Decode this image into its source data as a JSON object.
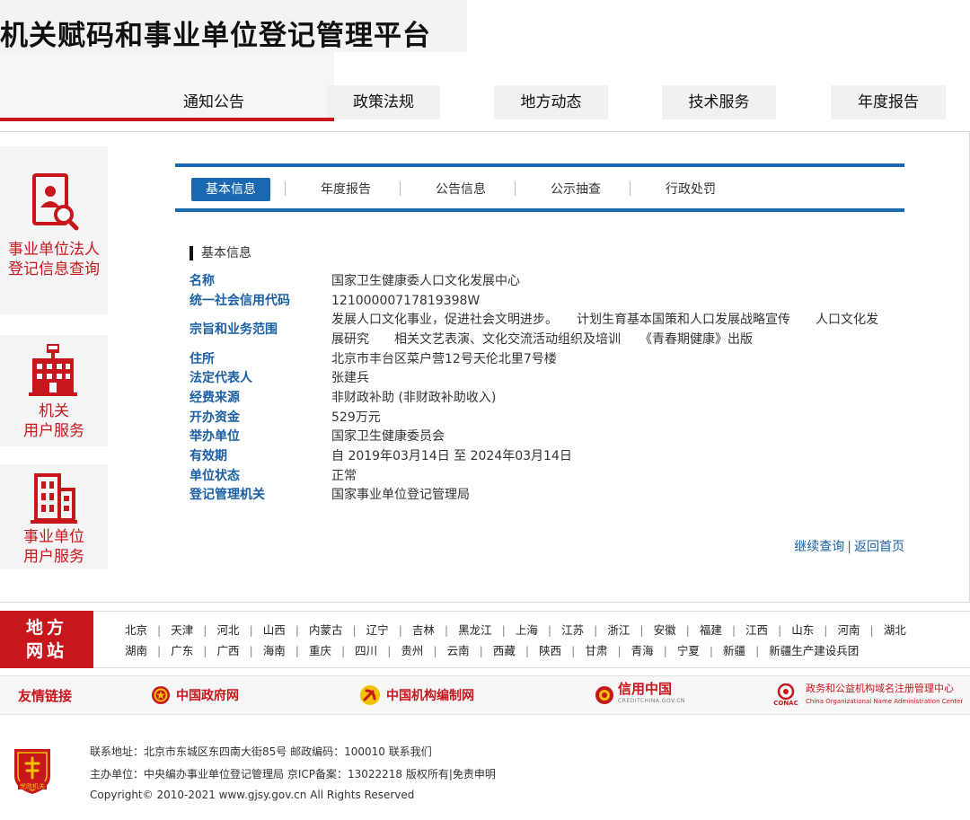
{
  "header": {
    "site_title": "机关赋码和事业单位登记管理平台",
    "nav": [
      {
        "label": "通知公告"
      },
      {
        "label": "政策法规"
      },
      {
        "label": "地方动态"
      },
      {
        "label": "技术服务"
      },
      {
        "label": "年度报告"
      }
    ]
  },
  "sidebar": {
    "items": [
      {
        "label_line1": "事业单位法人",
        "label_line2": "登记信息查询",
        "icon": "person-search-icon"
      },
      {
        "label_line1": "机关",
        "label_line2": "用户服务",
        "icon": "government-building-icon"
      },
      {
        "label_line1": "事业单位",
        "label_line2": "用户服务",
        "icon": "office-building-icon"
      }
    ]
  },
  "tabs": [
    {
      "label": "基本信息"
    },
    {
      "label": "年度报告"
    },
    {
      "label": "公告信息"
    },
    {
      "label": "公示抽查"
    },
    {
      "label": "行政处罚"
    }
  ],
  "info": {
    "section_title": "基本信息",
    "rows": [
      {
        "label": "名称",
        "value": "国家卫生健康委人口文化发展中心"
      },
      {
        "label": "统一社会信用代码",
        "value": "12100000717819398W"
      },
      {
        "label": "宗旨和业务范围",
        "value_line1": "发展人口文化事业，促进社会文明进步。　　计划生育基本国策和人口发展战略宣传　　人口文化发",
        "value_line2": "展研究　　相关文艺表演、文化交流活动组织及培训　　《青春期健康》出版"
      },
      {
        "label": "住所",
        "value": "北京市丰台区菜户营12号天伦北里7号楼"
      },
      {
        "label": "法定代表人",
        "value": "张建兵"
      },
      {
        "label": "经费来源",
        "value": "非财政补助 (非财政补助收入)"
      },
      {
        "label": "开办资金",
        "value": "529万元"
      },
      {
        "label": "举办单位",
        "value": "国家卫生健康委员会"
      },
      {
        "label": "有效期",
        "value": "自 2019年03月14日 至 2024年03月14日"
      },
      {
        "label": "单位状态",
        "value": "正常"
      },
      {
        "label": "登记管理机关",
        "value": "国家事业单位登记管理局"
      }
    ],
    "continue_link": "继续查询",
    "separator": "|",
    "home_link": "返回首页"
  },
  "regions": {
    "badge_line1": "地方",
    "badge_line2": "网站",
    "row1": [
      "北京",
      "天津",
      "河北",
      "山西",
      "内蒙古",
      "辽宁",
      "吉林",
      "黑龙江",
      "上海",
      "江苏",
      "浙江",
      "安徽",
      "福建",
      "江西",
      "山东",
      "河南",
      "湖北"
    ],
    "row2": [
      "湖南",
      "广东",
      "广西",
      "海南",
      "重庆",
      "四川",
      "贵州",
      "云南",
      "西藏",
      "陕西",
      "甘肃",
      "青海",
      "宁夏",
      "新疆",
      "新疆生产建设兵团"
    ]
  },
  "friend_links": {
    "title": "友情链接",
    "items": [
      {
        "label": "中国政府网",
        "icon": "national-emblem-icon"
      },
      {
        "label": "中国机构编制网",
        "icon": "party-emblem-icon"
      },
      {
        "label": "信用中国",
        "icon": "credit-china-icon",
        "sub": "CREDITCHINA.GOV.CN"
      },
      {
        "label": "政务和公益机构域名注册管理中心",
        "sub": "China Organizational Name Administration Center",
        "logo_text": "CONAC",
        "icon": "conac-logo-icon"
      }
    ]
  },
  "footer": {
    "line1": "联系地址：北京市东城区东四南大街85号 邮政编码：100010 联系我们",
    "line2": "主办单位：中央编办事业单位登记管理局 京ICP备案：13022218 版权所有|免责申明",
    "line3": "Copyright© 2010-2021 www.gjsy.gov.cn All Rights Reserved",
    "badge_text": "党政机关"
  },
  "colors": {
    "brand_red": "#c8161d",
    "link_blue": "#1a5fa5",
    "tab_blue": "#1a68b0"
  }
}
